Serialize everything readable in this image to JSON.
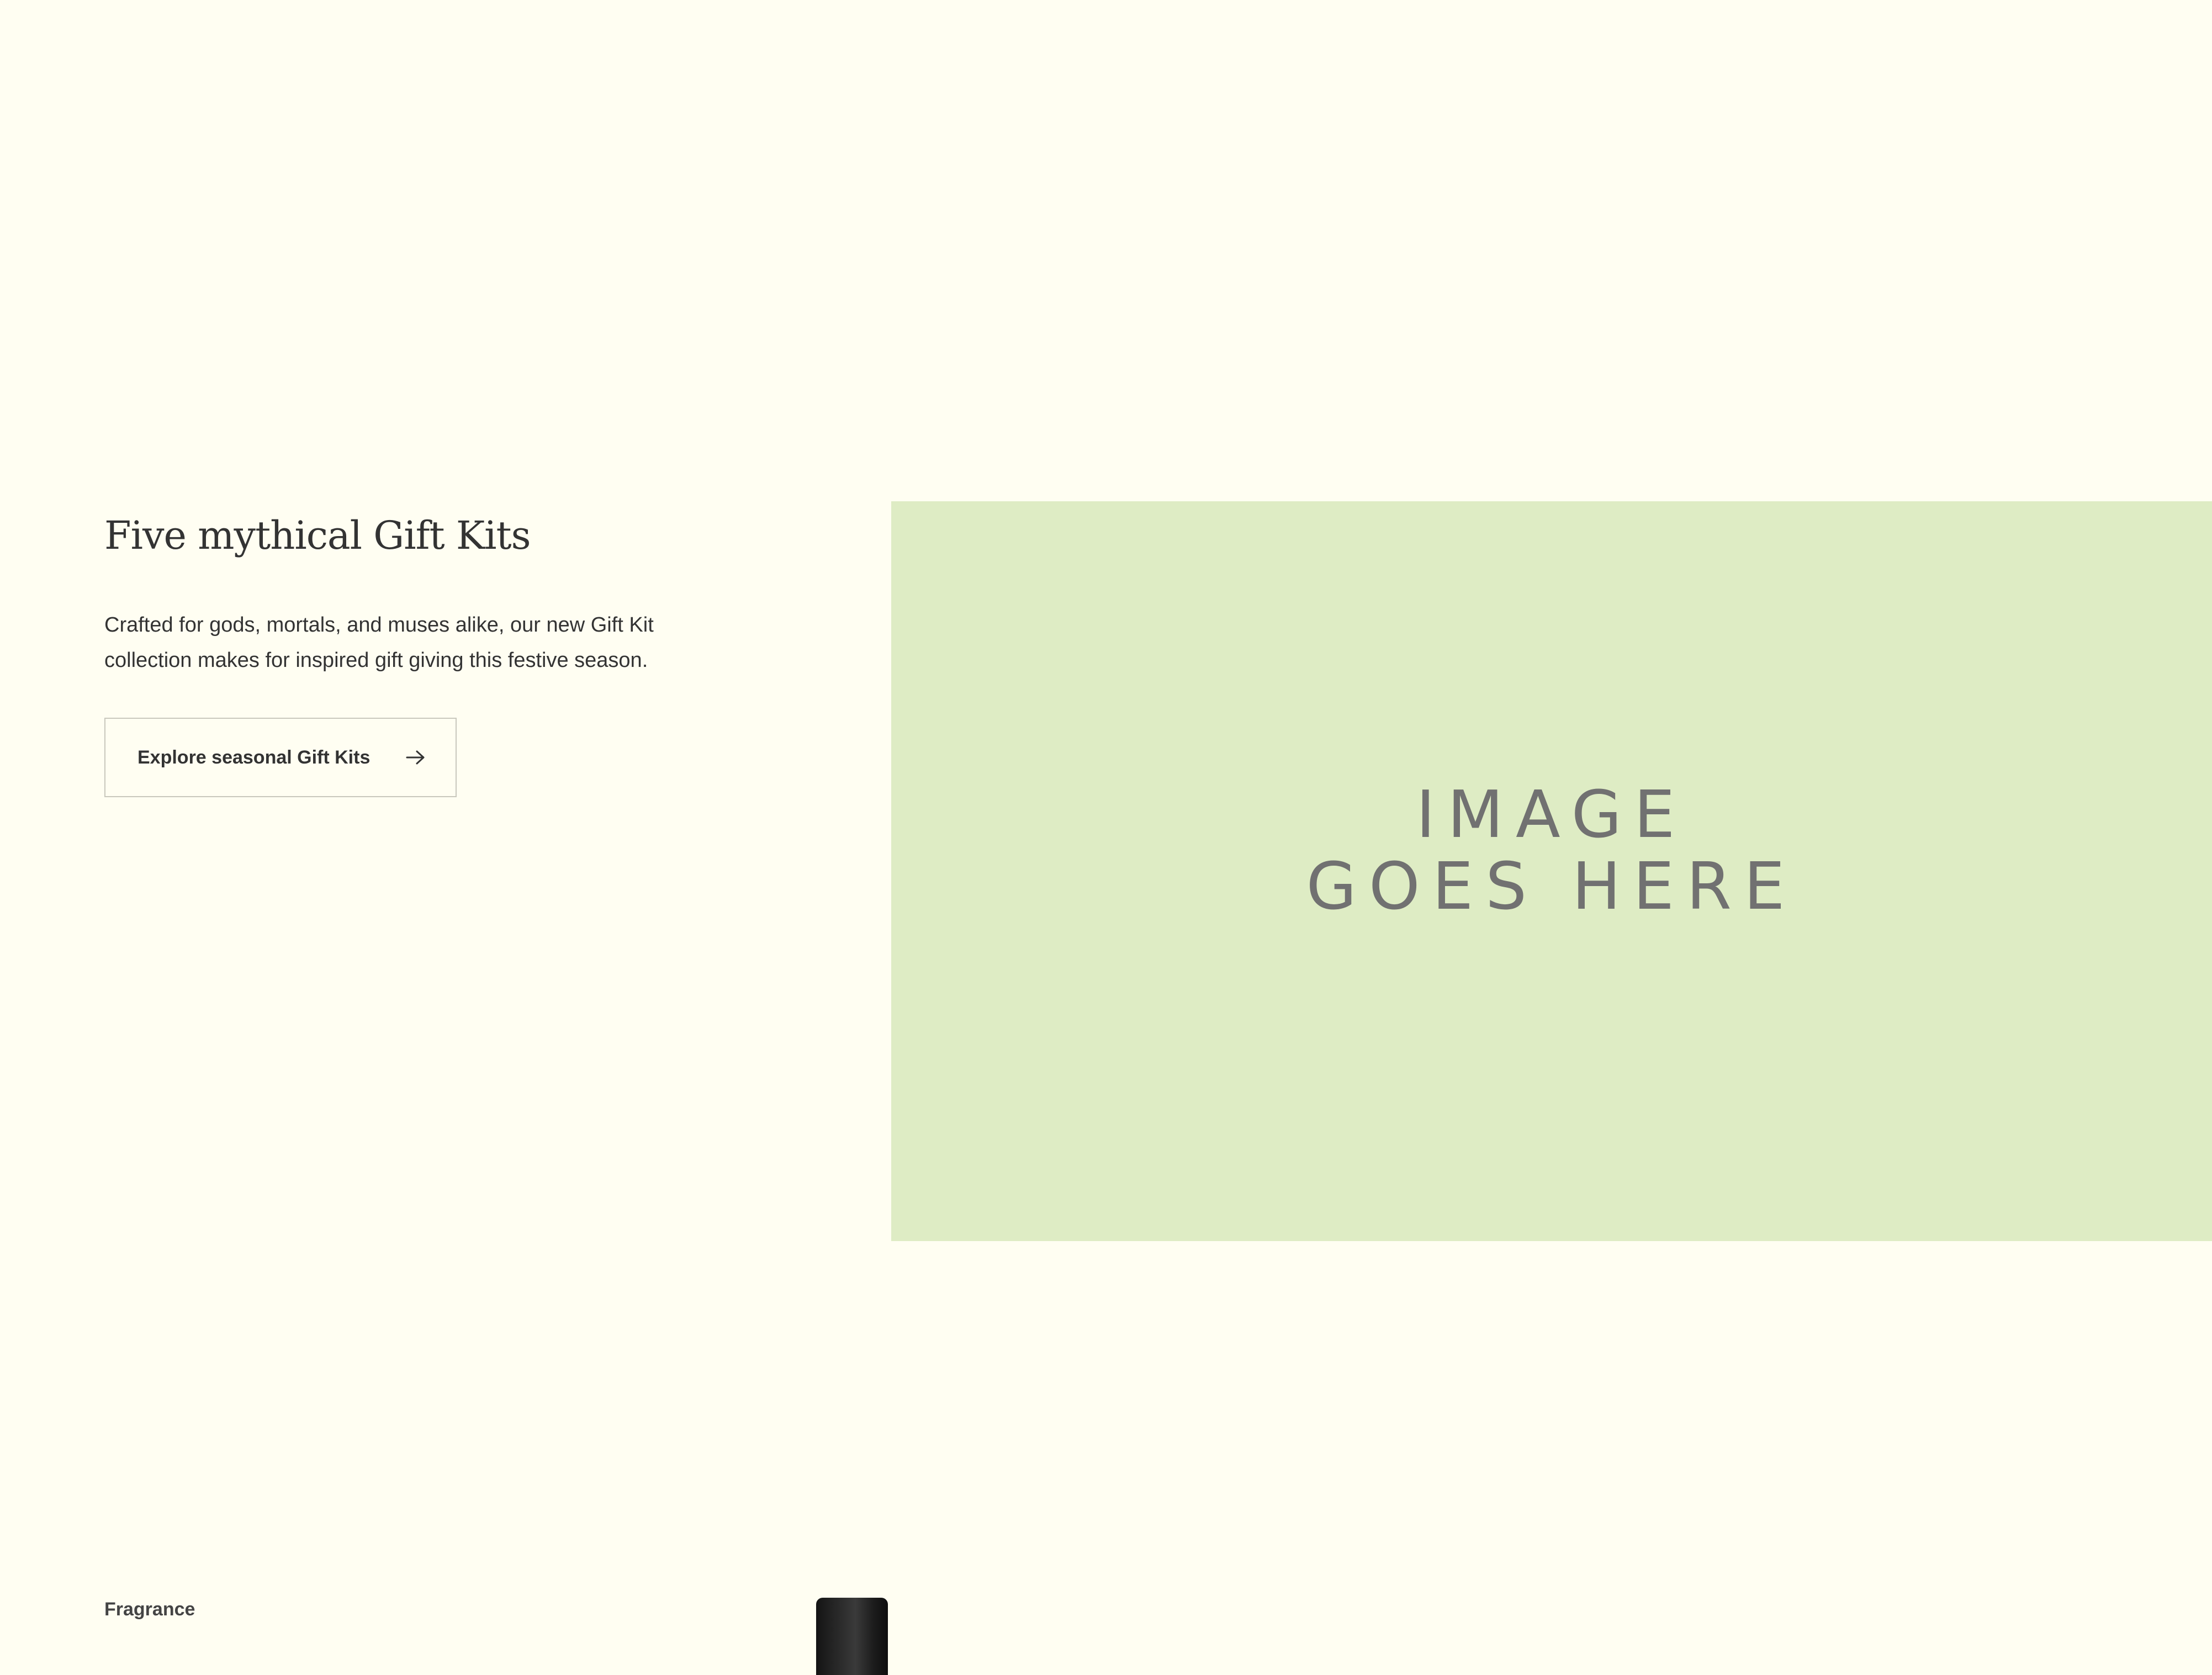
{
  "promo": {
    "title": "Five mythical Gift Kits",
    "body": "Crafted for gods, mortals, and muses alike, our new Gift Kit collection makes for inspired gift giving this festive season.",
    "cta_label": "Explore seasonal Gift Kits",
    "cta_icon": "arrow-right-icon"
  },
  "image_placeholder": {
    "line1": "IMAGE",
    "line2": "GOES HERE",
    "background": "#deecc4"
  },
  "section": {
    "label": "Fragrance"
  },
  "colors": {
    "page_background": "#fffef2",
    "text": "#333333",
    "button_border": "#c9c8bd"
  }
}
